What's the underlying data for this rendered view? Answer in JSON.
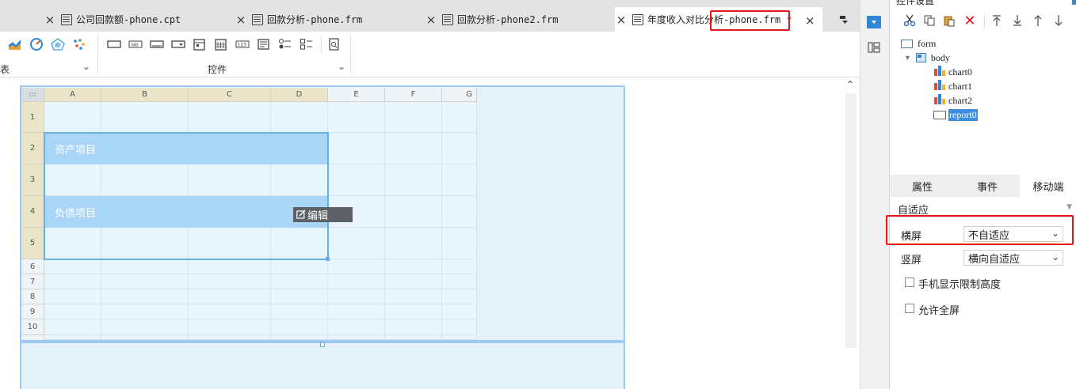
{
  "tabs": [
    {
      "title_cn": "公司回款额",
      "title_rest": "-phone.cpt",
      "active": false
    },
    {
      "title_cn": "回款分析",
      "title_rest": "-phone.frm",
      "active": false
    },
    {
      "title_cn": "回款分析",
      "title_rest": "-phone2.frm",
      "active": false
    },
    {
      "title_cn": "年度收入对比分析",
      "title_rest": "-phone.frm *",
      "active": true
    }
  ],
  "toolbar": {
    "group_left_label": "表",
    "group_controls_label": "控件",
    "edit_button_label": "编辑"
  },
  "sheet": {
    "columns": [
      "A",
      "B",
      "C",
      "D",
      "E",
      "F",
      "G"
    ],
    "rows": [
      "1",
      "2",
      "3",
      "4",
      "5",
      "6",
      "7",
      "8",
      "9",
      "10"
    ],
    "band_assets": "资产项目",
    "band_liabilities": "负债项目"
  },
  "panel": {
    "title": "控件设置",
    "tree": {
      "root": "form",
      "body": "body",
      "children": [
        "chart0",
        "chart1",
        "chart2",
        "report0"
      ],
      "selected": "report0"
    },
    "tabs": [
      "属性",
      "事件",
      "移动端"
    ],
    "active_tab": "移动端",
    "section_title": "自适应",
    "landscape_label": "横屏",
    "landscape_value": "不自适应",
    "portrait_label": "竖屏",
    "portrait_value": "横向自适应",
    "limit_height_label": "手机显示限制高度",
    "allow_fullscreen_label": "允许全屏"
  },
  "colors": {
    "highlight_red": "#e4161b",
    "band_blue": "#a9d6f7",
    "selection_blue": "#6aaee8",
    "tree_selected": "#3c8fe0"
  }
}
